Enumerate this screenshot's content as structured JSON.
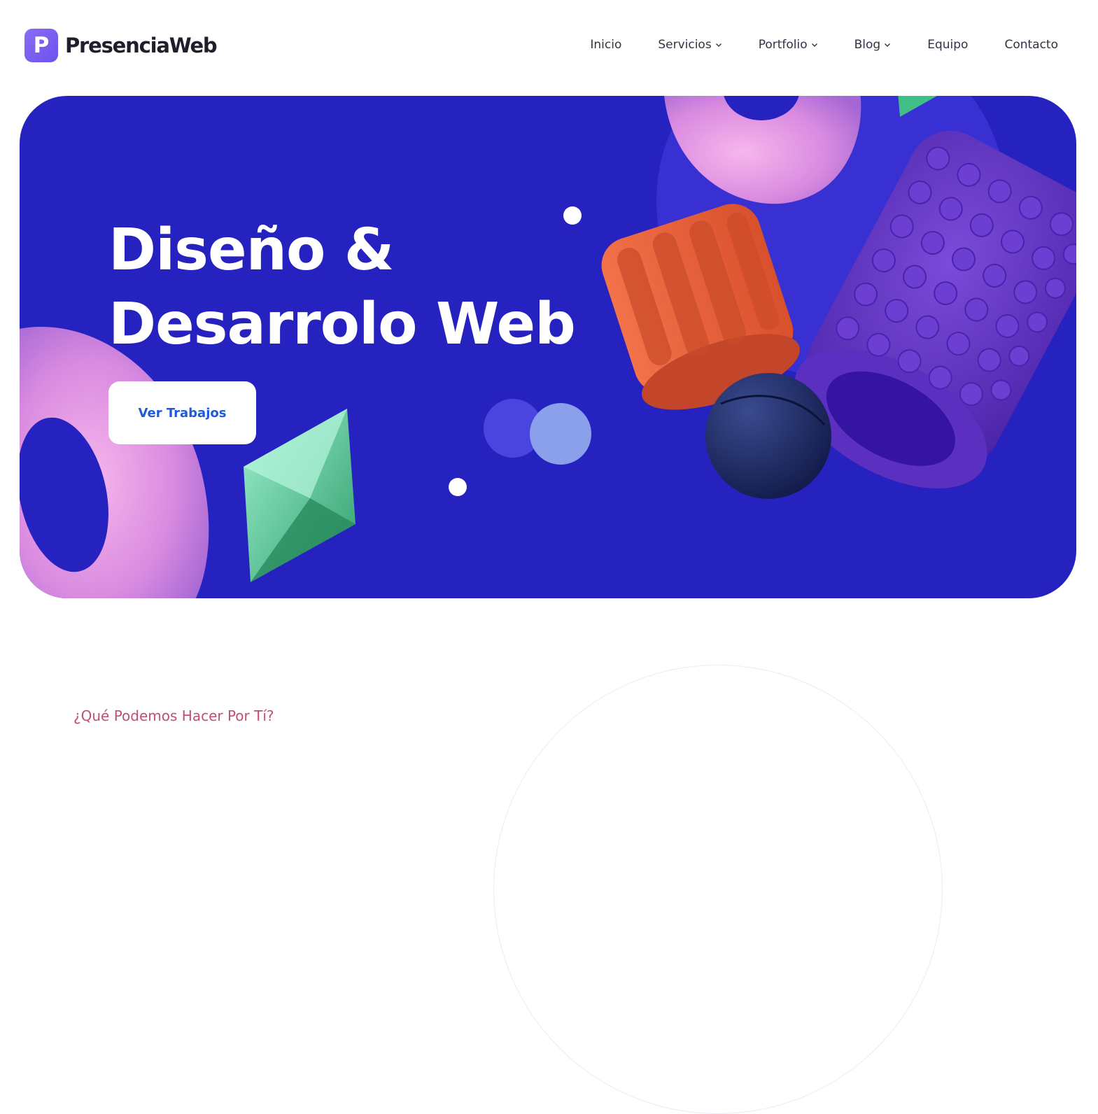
{
  "brand": {
    "logo_letter": "P",
    "name": "PresenciaWeb",
    "accent": "#7c5cf3"
  },
  "nav": {
    "items": [
      {
        "label": "Inicio",
        "dropdown": false
      },
      {
        "label": "Servicios",
        "dropdown": true
      },
      {
        "label": "Portfolio",
        "dropdown": true
      },
      {
        "label": "Blog",
        "dropdown": true
      },
      {
        "label": "Equipo",
        "dropdown": false
      },
      {
        "label": "Contacto",
        "dropdown": false
      }
    ]
  },
  "hero": {
    "title_line1": "Diseño &",
    "title_line2": "Desarrolo Web",
    "cta_label": "Ver Trabajos",
    "background": "#2622bf"
  },
  "section": {
    "eyebrow": "¿Qué Podemos Hacer Por Tí?"
  }
}
